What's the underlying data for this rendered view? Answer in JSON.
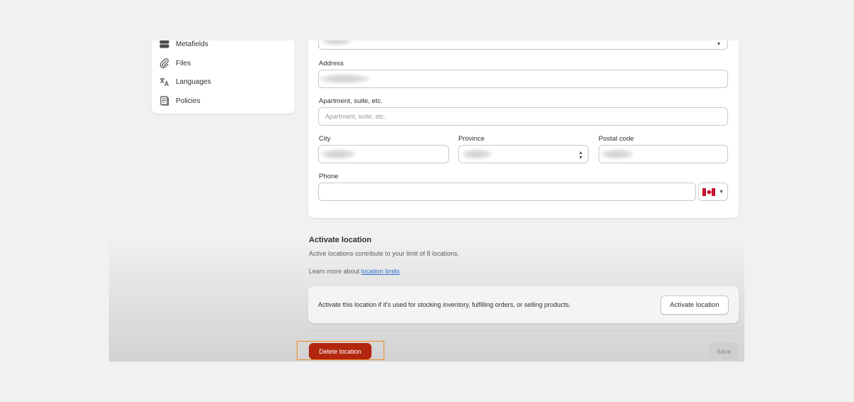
{
  "sidebar": {
    "items": [
      {
        "label": "Metafields",
        "icon": "metafields-icon"
      },
      {
        "label": "Files",
        "icon": "paperclip-icon"
      },
      {
        "label": "Languages",
        "icon": "translate-icon"
      },
      {
        "label": "Policies",
        "icon": "document-icon"
      }
    ]
  },
  "form": {
    "address_label": "Address",
    "apartment_label": "Apartment, suite, etc.",
    "apartment_placeholder": "Apartment, suite, etc.",
    "city_label": "City",
    "province_label": "Province",
    "postal_label": "Postal code",
    "phone_label": "Phone",
    "phone_country": "Canada"
  },
  "activate": {
    "heading": "Activate location",
    "description": "Active locations contribute to your limit of 8 locations.",
    "learn_prefix": "Learn more about ",
    "learn_link": "location limits",
    "card_text": "Activate this location if it's used for stocking inventory, fulfilling orders, or selling products.",
    "button_label": "Activate location"
  },
  "footer": {
    "delete_label": "Delete location",
    "save_label": "Save"
  },
  "colors": {
    "danger": "#b3260f",
    "highlight": "#f08a24",
    "link": "#2c6ecb"
  }
}
